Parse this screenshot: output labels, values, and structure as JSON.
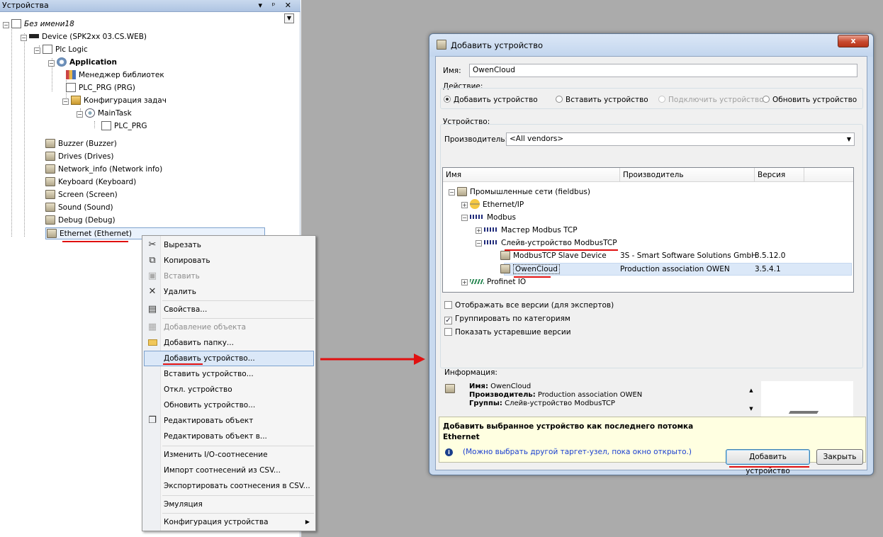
{
  "panel": {
    "title": "Устройства",
    "controls": [
      "▾",
      "ᵖ",
      "✕"
    ]
  },
  "tree": {
    "project": "Без имени18",
    "device": "Device (SPK2xx 03.CS.WEB)",
    "plc_logic": "Plc Logic",
    "application": "Application",
    "library_manager": "Менеджер библиотек",
    "plc_prg": "PLC_PRG (PRG)",
    "task_config": "Конфигурация задач",
    "main_task": "MainTask",
    "plc_prg_call": "PLC_PRG",
    "modules": [
      "Buzzer (Buzzer)",
      "Drives (Drives)",
      "Network_info (Network info)",
      "Keyboard (Keyboard)",
      "Screen (Screen)",
      "Sound (Sound)",
      "Debug (Debug)",
      "Ethernet (Ethernet)"
    ]
  },
  "context_menu": [
    {
      "label": "Вырезать",
      "icon": "cut-icon",
      "glyph": "✂",
      "disabled": false
    },
    {
      "label": "Копировать",
      "icon": "copy-icon",
      "glyph": "⧉",
      "disabled": false
    },
    {
      "label": "Вставить",
      "icon": "paste-icon",
      "glyph": "📋",
      "disabled": true
    },
    {
      "label": "Удалить",
      "icon": "delete-icon",
      "glyph": "✕",
      "disabled": false
    },
    {
      "label": "Свойства...",
      "icon": "properties-icon",
      "glyph": "▤",
      "disabled": false
    },
    {
      "label": "Добавление объекта",
      "icon": "add-object-icon",
      "glyph": "▦",
      "disabled": true
    },
    {
      "label": "Добавить папку...",
      "icon": "folder-icon",
      "glyph": "",
      "disabled": false
    },
    {
      "label": "Добавить устройство...",
      "icon": "",
      "glyph": "",
      "disabled": false
    },
    {
      "label": "Вставить устройство...",
      "icon": "",
      "glyph": "",
      "disabled": false
    },
    {
      "label": "Откл. устройство",
      "icon": "",
      "glyph": "",
      "disabled": false
    },
    {
      "label": "Обновить устройство...",
      "icon": "",
      "glyph": "",
      "disabled": false
    },
    {
      "label": "Редактировать объект",
      "icon": "edit-object-icon",
      "glyph": "❐",
      "disabled": false
    },
    {
      "label": "Редактировать объект в...",
      "icon": "",
      "glyph": "",
      "disabled": false
    },
    {
      "label": "Изменить I/O-соотнесение",
      "icon": "",
      "glyph": "",
      "disabled": false
    },
    {
      "label": "Импорт соотнесений из CSV...",
      "icon": "",
      "glyph": "",
      "disabled": false
    },
    {
      "label": "Экспортировать соотнесения в CSV...",
      "icon": "",
      "glyph": "",
      "disabled": false
    },
    {
      "label": "Эмуляция",
      "icon": "",
      "glyph": "",
      "disabled": false
    },
    {
      "label": "Конфигурация устройства",
      "icon": "",
      "glyph": "",
      "disabled": false
    }
  ],
  "dialog": {
    "title": "Добавить устройство",
    "close_label": "x",
    "name_label": "Имя:",
    "name_value": "OwenCloud",
    "action_label": "Действие:",
    "actions": [
      "Добавить устройство",
      "Вставить устройство",
      "Подключить устройство",
      "Обновить устройство"
    ],
    "device_label": "Устройство:",
    "vendor_label": "Производитель:",
    "vendor_value": "<All vendors>",
    "columns": [
      "Имя",
      "Производитель",
      "Версия"
    ],
    "rows": {
      "fieldbus": "Промышленные сети (fieldbus)",
      "ethernet_ip": "Ethernet/IP",
      "modbus": "Modbus",
      "master_tcp": "Мастер Modbus TCP",
      "slave_tcp": "Слейв-устройство ModbusTCP",
      "slave_device": "ModbusTCP Slave Device",
      "slave_device_vendor": "3S - Smart Software Solutions GmbH",
      "slave_device_version": "3.5.12.0",
      "owencloud": "OwenCloud",
      "owencloud_vendor": "Production association OWEN",
      "owencloud_version": "3.5.4.1",
      "profinet": "Profinet IO"
    },
    "checkboxes": [
      {
        "label": "Отображать все версии (для экспертов)",
        "checked": false
      },
      {
        "label": "Группировать по категориям",
        "checked": true
      },
      {
        "label": "Показать устаревшие версии",
        "checked": false
      }
    ],
    "info_label": "Информация:",
    "info": {
      "name_key": "Имя:",
      "name_val": "OwenCloud",
      "vendor_key": "Производитель:",
      "vendor_val": "Production association OWEN",
      "groups_key": "Группы:",
      "groups_val": "Слейв-устройство ModbusTCP"
    },
    "hint_line1": "Добавить выбранное устройство как последнего потомка",
    "hint_line2": "Ethernet",
    "hint_note": "(Можно выбрать другой таргет-узел, пока окно открыто.)",
    "add_button": "Добавить устройство",
    "close_button": "Закрыть"
  }
}
